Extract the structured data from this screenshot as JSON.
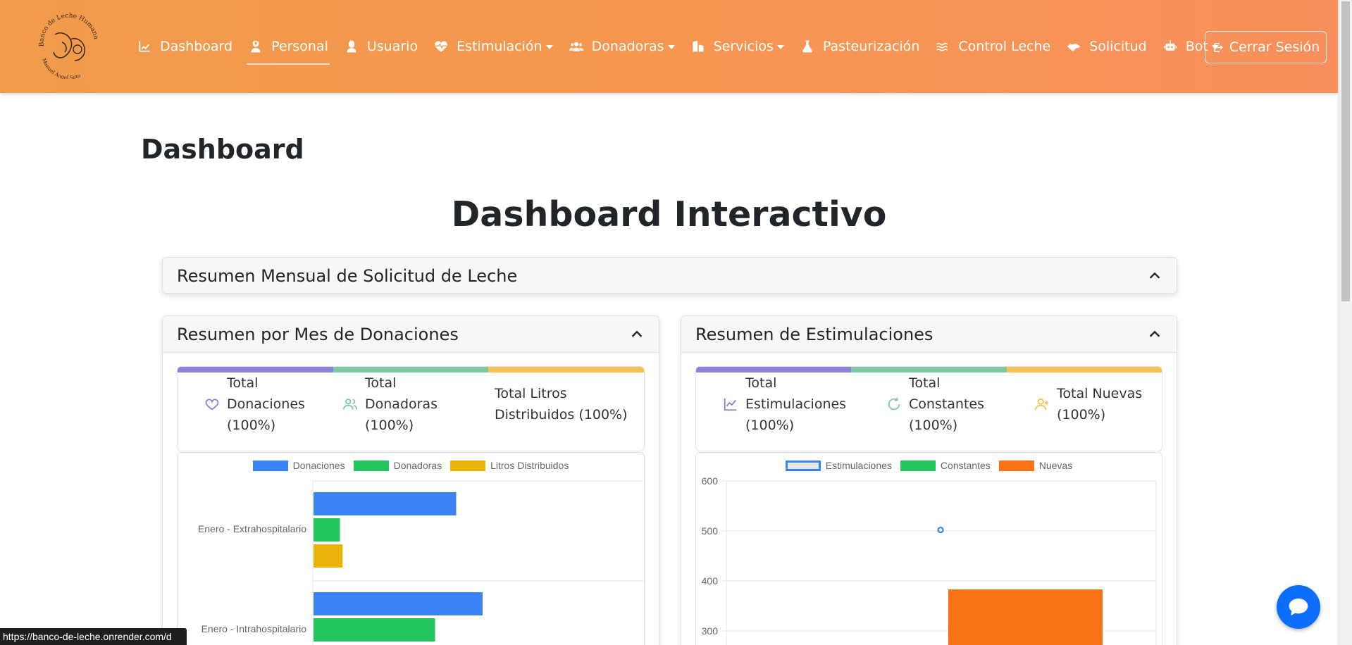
{
  "navbar": {
    "logo_text": "Banco de Leche Humana — Manuel Ángel Soto",
    "items": [
      {
        "label": "Dashboard",
        "icon": "chart-line-icon"
      },
      {
        "label": "Personal",
        "icon": "user-nurse-icon",
        "active": true
      },
      {
        "label": "Usuario",
        "icon": "user-icon"
      },
      {
        "label": "Estimulación",
        "icon": "heart-pulse-icon",
        "dropdown": true
      },
      {
        "label": "Donadoras",
        "icon": "users-icon",
        "dropdown": true
      },
      {
        "label": "Servicios",
        "icon": "building-icon",
        "dropdown": true
      },
      {
        "label": "Pasteurización",
        "icon": "flask-icon"
      },
      {
        "label": "Control Leche",
        "icon": "water-icon"
      },
      {
        "label": "Solicitud",
        "icon": "handshake-icon"
      },
      {
        "label": "Bot",
        "icon": "robot-icon",
        "dropdown": true
      }
    ],
    "logout_label": "Cerrar Sesión"
  },
  "page_title": "Dashboard",
  "main_title": "Dashboard Interactivo",
  "accordions": {
    "solicitud": "Resumen Mensual de Solicitud de Leche",
    "donaciones": "Resumen por Mes de Donaciones",
    "estimulaciones": "Resumen de Estimulaciones"
  },
  "donaciones_stats": [
    {
      "lines": [
        "Total",
        "Donaciones",
        "(100%)"
      ],
      "icon": "heart-icon",
      "color": "#8b7fd6"
    },
    {
      "lines": [
        "Total",
        "Donadoras",
        "(100%)"
      ],
      "icon": "users-icon",
      "color": "#7fc9a0"
    },
    {
      "lines": [
        "Total Litros",
        "Distribuidos (100%)"
      ],
      "icon": "",
      "color": "#f6c154"
    }
  ],
  "estimulaciones_stats": [
    {
      "lines": [
        "Total",
        "Estimulaciones",
        "(100%)"
      ],
      "icon": "trend-icon",
      "color": "#8b7fd6"
    },
    {
      "lines": [
        "Total",
        "Constantes",
        "(100%)"
      ],
      "icon": "refresh-icon",
      "color": "#7fc9a0"
    },
    {
      "lines": [
        "Total Nuevas",
        "(100%)"
      ],
      "icon": "user-plus-icon",
      "color": "#f6c154"
    }
  ],
  "stat_bar_colors": [
    "#8a83d7",
    "#7fc9a0",
    "#f6c154"
  ],
  "chart_data": [
    {
      "type": "bar",
      "orientation": "horizontal",
      "categories": [
        "Enero - Extrahospitalario",
        "Enero - Intrahospitalario"
      ],
      "series": [
        {
          "name": "Donaciones",
          "color": "#3b82f6",
          "values": [
            27,
            32
          ]
        },
        {
          "name": "Donadoras",
          "color": "#22c55e",
          "values": [
            5,
            23
          ]
        },
        {
          "name": "Litros Distribuidos",
          "color": "#eab308",
          "values": [
            5.5,
            null
          ]
        }
      ],
      "xlim": [
        0,
        60
      ],
      "legend": "top"
    },
    {
      "type": "bar",
      "categories": [
        "",
        ""
      ],
      "series": [
        {
          "name": "Estimulaciones",
          "type": "line",
          "values": [
            null,
            502
          ]
        },
        {
          "name": "Constantes",
          "color": "#22c55e",
          "values": [
            null,
            null
          ]
        },
        {
          "name": "Nuevas",
          "color": "#f97316",
          "values": [
            null,
            383
          ]
        }
      ],
      "y_ticks": [
        "600",
        "500",
        "400",
        "300"
      ],
      "ylim": [
        300,
        600
      ],
      "grid": true,
      "legend": "top"
    }
  ],
  "chat_icon": "chat-bubble-icon",
  "status_url": "https://banco-de-leche.onrender.com/d"
}
